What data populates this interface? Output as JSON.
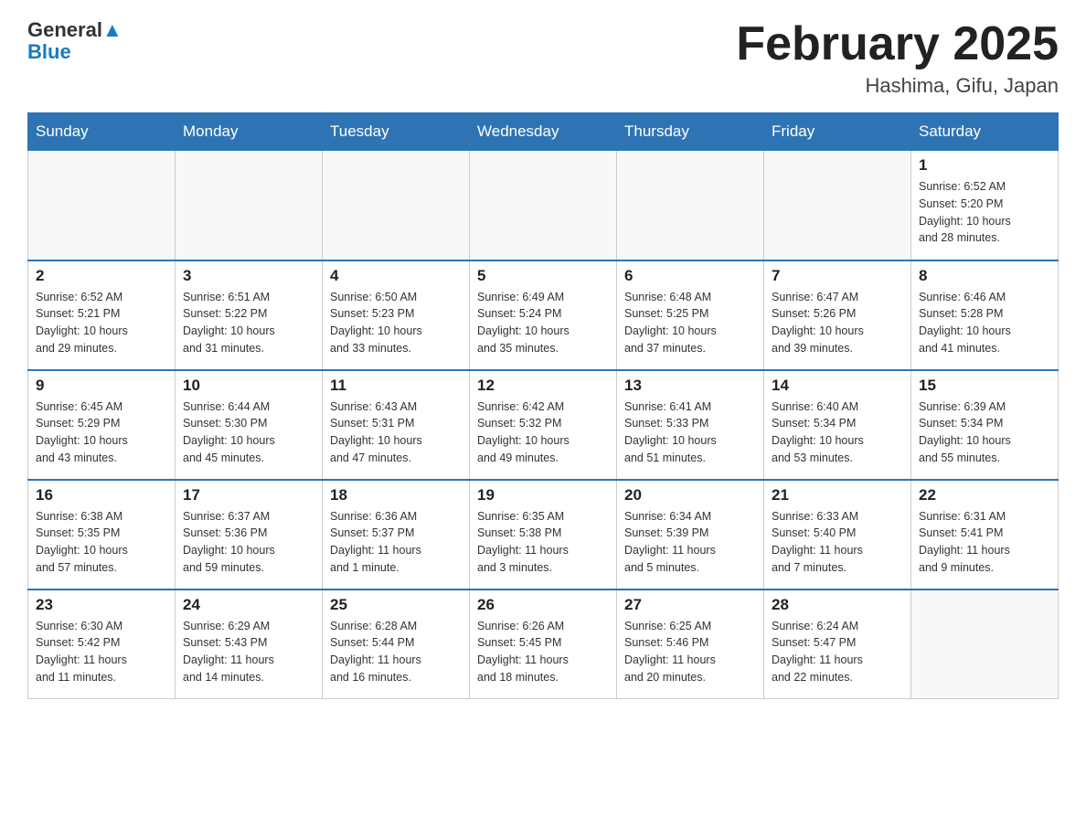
{
  "header": {
    "title": "February 2025",
    "location": "Hashima, Gifu, Japan",
    "logo_general": "General",
    "logo_blue": "Blue"
  },
  "days_of_week": [
    "Sunday",
    "Monday",
    "Tuesday",
    "Wednesday",
    "Thursday",
    "Friday",
    "Saturday"
  ],
  "weeks": [
    [
      {
        "day": "",
        "info": ""
      },
      {
        "day": "",
        "info": ""
      },
      {
        "day": "",
        "info": ""
      },
      {
        "day": "",
        "info": ""
      },
      {
        "day": "",
        "info": ""
      },
      {
        "day": "",
        "info": ""
      },
      {
        "day": "1",
        "info": "Sunrise: 6:52 AM\nSunset: 5:20 PM\nDaylight: 10 hours\nand 28 minutes."
      }
    ],
    [
      {
        "day": "2",
        "info": "Sunrise: 6:52 AM\nSunset: 5:21 PM\nDaylight: 10 hours\nand 29 minutes."
      },
      {
        "day": "3",
        "info": "Sunrise: 6:51 AM\nSunset: 5:22 PM\nDaylight: 10 hours\nand 31 minutes."
      },
      {
        "day": "4",
        "info": "Sunrise: 6:50 AM\nSunset: 5:23 PM\nDaylight: 10 hours\nand 33 minutes."
      },
      {
        "day": "5",
        "info": "Sunrise: 6:49 AM\nSunset: 5:24 PM\nDaylight: 10 hours\nand 35 minutes."
      },
      {
        "day": "6",
        "info": "Sunrise: 6:48 AM\nSunset: 5:25 PM\nDaylight: 10 hours\nand 37 minutes."
      },
      {
        "day": "7",
        "info": "Sunrise: 6:47 AM\nSunset: 5:26 PM\nDaylight: 10 hours\nand 39 minutes."
      },
      {
        "day": "8",
        "info": "Sunrise: 6:46 AM\nSunset: 5:28 PM\nDaylight: 10 hours\nand 41 minutes."
      }
    ],
    [
      {
        "day": "9",
        "info": "Sunrise: 6:45 AM\nSunset: 5:29 PM\nDaylight: 10 hours\nand 43 minutes."
      },
      {
        "day": "10",
        "info": "Sunrise: 6:44 AM\nSunset: 5:30 PM\nDaylight: 10 hours\nand 45 minutes."
      },
      {
        "day": "11",
        "info": "Sunrise: 6:43 AM\nSunset: 5:31 PM\nDaylight: 10 hours\nand 47 minutes."
      },
      {
        "day": "12",
        "info": "Sunrise: 6:42 AM\nSunset: 5:32 PM\nDaylight: 10 hours\nand 49 minutes."
      },
      {
        "day": "13",
        "info": "Sunrise: 6:41 AM\nSunset: 5:33 PM\nDaylight: 10 hours\nand 51 minutes."
      },
      {
        "day": "14",
        "info": "Sunrise: 6:40 AM\nSunset: 5:34 PM\nDaylight: 10 hours\nand 53 minutes."
      },
      {
        "day": "15",
        "info": "Sunrise: 6:39 AM\nSunset: 5:34 PM\nDaylight: 10 hours\nand 55 minutes."
      }
    ],
    [
      {
        "day": "16",
        "info": "Sunrise: 6:38 AM\nSunset: 5:35 PM\nDaylight: 10 hours\nand 57 minutes."
      },
      {
        "day": "17",
        "info": "Sunrise: 6:37 AM\nSunset: 5:36 PM\nDaylight: 10 hours\nand 59 minutes."
      },
      {
        "day": "18",
        "info": "Sunrise: 6:36 AM\nSunset: 5:37 PM\nDaylight: 11 hours\nand 1 minute."
      },
      {
        "day": "19",
        "info": "Sunrise: 6:35 AM\nSunset: 5:38 PM\nDaylight: 11 hours\nand 3 minutes."
      },
      {
        "day": "20",
        "info": "Sunrise: 6:34 AM\nSunset: 5:39 PM\nDaylight: 11 hours\nand 5 minutes."
      },
      {
        "day": "21",
        "info": "Sunrise: 6:33 AM\nSunset: 5:40 PM\nDaylight: 11 hours\nand 7 minutes."
      },
      {
        "day": "22",
        "info": "Sunrise: 6:31 AM\nSunset: 5:41 PM\nDaylight: 11 hours\nand 9 minutes."
      }
    ],
    [
      {
        "day": "23",
        "info": "Sunrise: 6:30 AM\nSunset: 5:42 PM\nDaylight: 11 hours\nand 11 minutes."
      },
      {
        "day": "24",
        "info": "Sunrise: 6:29 AM\nSunset: 5:43 PM\nDaylight: 11 hours\nand 14 minutes."
      },
      {
        "day": "25",
        "info": "Sunrise: 6:28 AM\nSunset: 5:44 PM\nDaylight: 11 hours\nand 16 minutes."
      },
      {
        "day": "26",
        "info": "Sunrise: 6:26 AM\nSunset: 5:45 PM\nDaylight: 11 hours\nand 18 minutes."
      },
      {
        "day": "27",
        "info": "Sunrise: 6:25 AM\nSunset: 5:46 PM\nDaylight: 11 hours\nand 20 minutes."
      },
      {
        "day": "28",
        "info": "Sunrise: 6:24 AM\nSunset: 5:47 PM\nDaylight: 11 hours\nand 22 minutes."
      },
      {
        "day": "",
        "info": ""
      }
    ]
  ],
  "colors": {
    "header_bg": "#2e74b5",
    "header_text": "#ffffff",
    "border": "#2e74b5"
  }
}
